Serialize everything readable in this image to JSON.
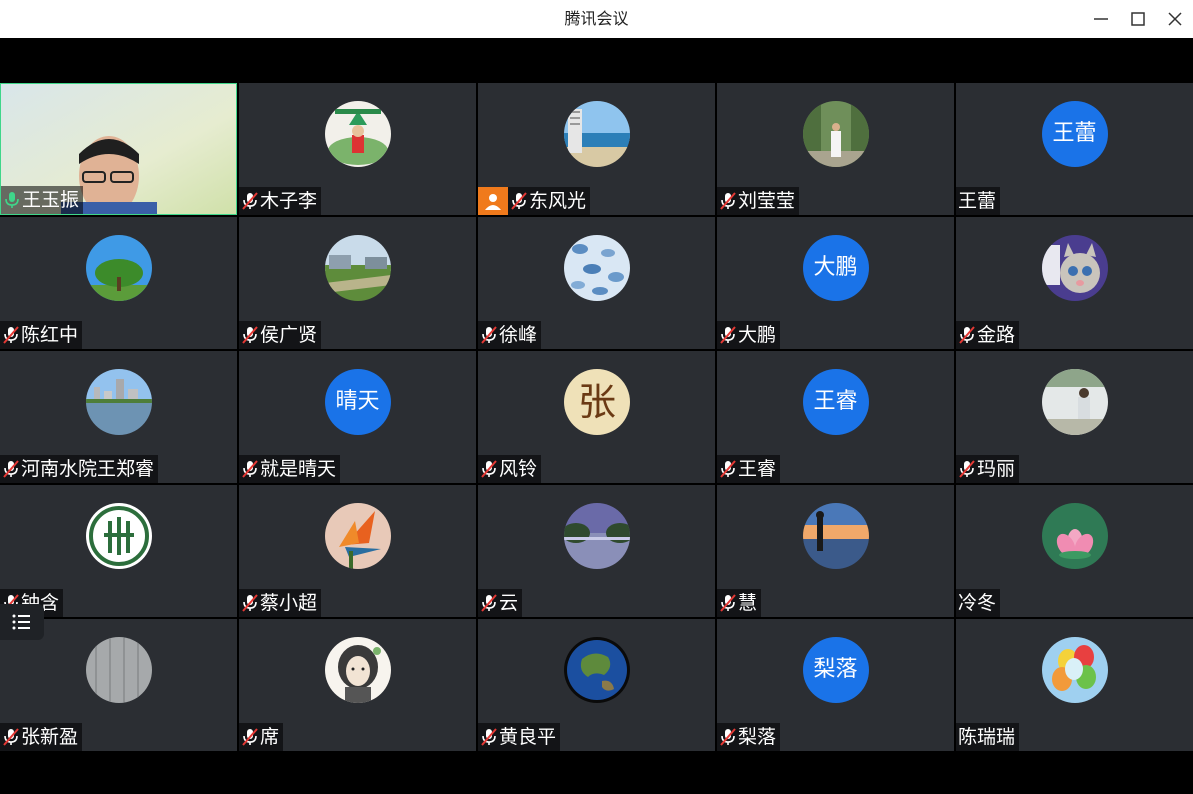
{
  "window": {
    "title": "腾讯会议"
  },
  "colors": {
    "avatar_bg": "#1a73e8",
    "self_border": "#3fd68a",
    "tile_bg": "#2b2e33",
    "mic_on": "#3fd68a",
    "mic_off": "#ffffff"
  },
  "participants": [
    {
      "name": "王玉振",
      "mic": "on",
      "avatar": "video"
    },
    {
      "name": "木子李",
      "mic": "muted",
      "avatar": "photo-garden"
    },
    {
      "name": "东风光",
      "mic": "muted",
      "avatar": "photo-beach",
      "badge": "person-icon"
    },
    {
      "name": "刘莹莹",
      "mic": "muted",
      "avatar": "photo-woman-trees"
    },
    {
      "name": "王蕾",
      "mic": "none",
      "avatar_text": "王蕾"
    },
    {
      "name": "陈红中",
      "mic": "muted",
      "avatar": "photo-tree"
    },
    {
      "name": "侯广贤",
      "mic": "muted",
      "avatar": "photo-park"
    },
    {
      "name": "徐峰",
      "mic": "muted",
      "avatar": "photo-pattern"
    },
    {
      "name": "大鹏",
      "mic": "muted",
      "avatar_text": "大鹏"
    },
    {
      "name": "金路",
      "mic": "muted",
      "avatar": "photo-cat"
    },
    {
      "name": "河南水院王郑睿",
      "mic": "muted",
      "avatar": "photo-city"
    },
    {
      "name": "就是晴天",
      "mic": "muted",
      "avatar_text": "晴天"
    },
    {
      "name": "风铃",
      "mic": "muted",
      "avatar": "photo-zhang"
    },
    {
      "name": "王睿",
      "mic": "muted",
      "avatar_text": "王睿"
    },
    {
      "name": "玛丽",
      "mic": "muted",
      "avatar": "photo-woman"
    },
    {
      "name": "钟含",
      "mic": "muted",
      "avatar": "photo-emblem"
    },
    {
      "name": "蔡小超",
      "mic": "muted",
      "avatar": "photo-flower"
    },
    {
      "name": "云",
      "mic": "muted",
      "avatar": "photo-lake"
    },
    {
      "name": "慧",
      "mic": "muted",
      "avatar": "photo-sunset"
    },
    {
      "name": "冷冬",
      "mic": "none",
      "avatar": "photo-lotus"
    },
    {
      "name": "张新盈",
      "mic": "muted",
      "avatar": "photo-gray"
    },
    {
      "name": "席",
      "mic": "muted",
      "avatar": "photo-girl-sketch"
    },
    {
      "name": "黄良平",
      "mic": "muted",
      "avatar": "photo-earth"
    },
    {
      "name": "梨落",
      "mic": "muted",
      "avatar_text": "梨落"
    },
    {
      "name": "陈瑞瑞",
      "mic": "none",
      "avatar": "photo-balloons"
    }
  ]
}
